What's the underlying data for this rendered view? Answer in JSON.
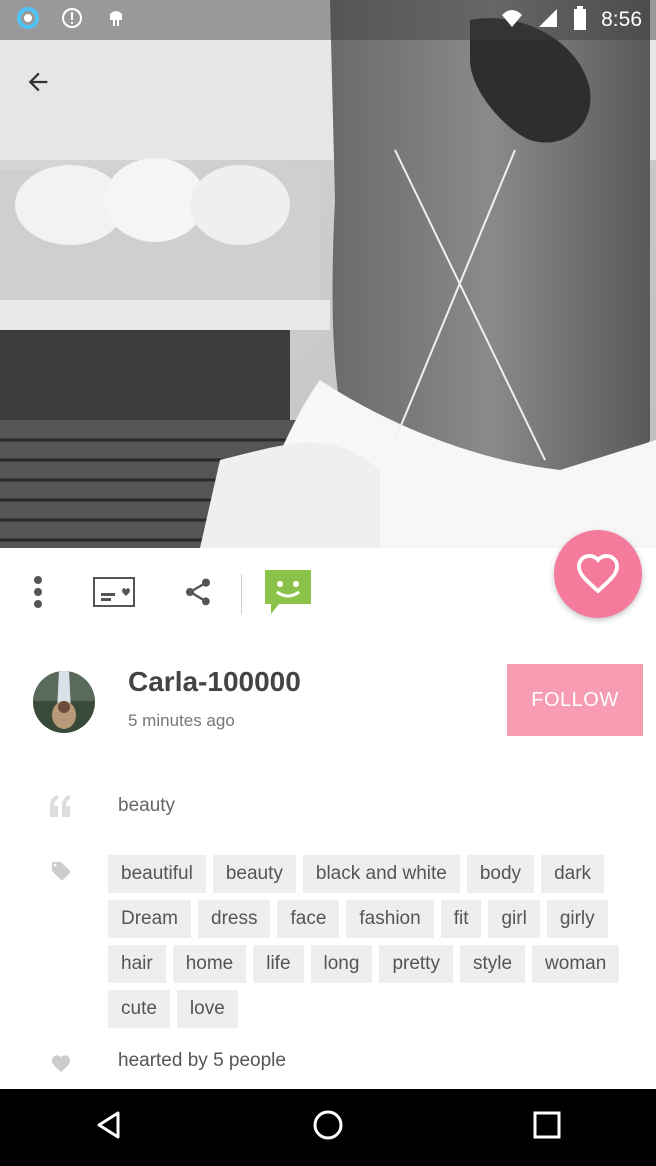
{
  "status_bar": {
    "time": "8:56"
  },
  "user": {
    "name": "Carla-100000",
    "posted": "5 minutes ago",
    "follow_label": "FOLLOW"
  },
  "post": {
    "description": "beauty",
    "tags": [
      "beautiful",
      "beauty",
      "black and white",
      "body",
      "dark",
      "Dream",
      "dress",
      "face",
      "fashion",
      "fit",
      "girl",
      "girly",
      "hair",
      "home",
      "life",
      "long",
      "pretty",
      "style",
      "woman",
      "cute",
      "love"
    ],
    "hearted_text": "hearted by 5 people"
  },
  "colors": {
    "accent_pink": "#f47b9b",
    "follow_pink": "#f79cb3",
    "chat_green": "#8bc34a"
  },
  "icons": [
    "back-arrow-icon",
    "more-vert-icon",
    "card-icon",
    "share-icon",
    "chat-smile-icon",
    "heart-icon",
    "quote-icon",
    "tag-icon",
    "back-nav-icon",
    "home-nav-icon",
    "recents-nav-icon"
  ]
}
